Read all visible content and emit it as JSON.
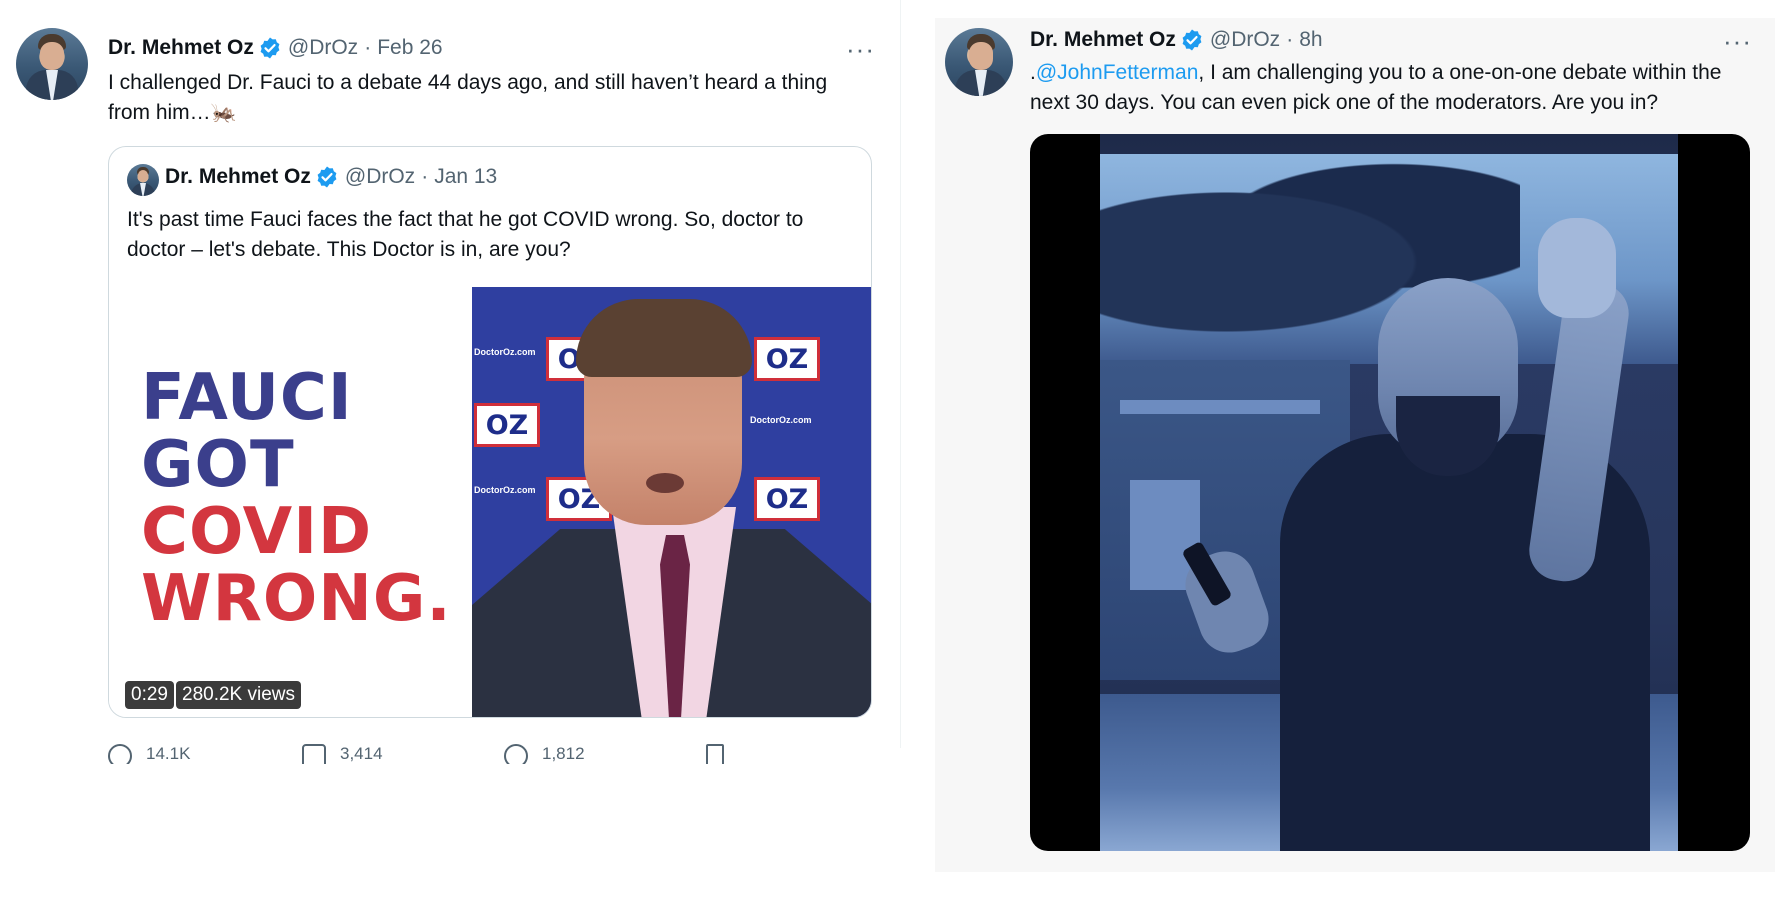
{
  "left_tweet": {
    "author_name": "Dr. Mehmet Oz",
    "handle": "@DrOz",
    "date": "Feb 26",
    "separator": "·",
    "more": "···",
    "text": "I challenged Dr. Fauci to a debate 44 days ago, and still haven’t heard a thing from him…🦗",
    "quoted": {
      "author_name": "Dr. Mehmet Oz",
      "handle": "@DrOz",
      "date": "Jan 13",
      "separator": "·",
      "text": "It's past time Fauci faces the fact that he got COVID wrong. So, doctor to doctor – let's debate. This Doctor is in, are you?",
      "media_lines": [
        {
          "text": "FAUCI",
          "color": "#3b3f8c"
        },
        {
          "text": "GOT",
          "color": "#3b3f8c"
        },
        {
          "text": "COVID",
          "color": "#d3363f"
        },
        {
          "text": "WRONG.",
          "color": "#d3363f"
        }
      ],
      "backdrop_logo": "OZ",
      "backdrop_url": "DoctorOz.com",
      "duration": "0:29",
      "views": "280.2K views"
    },
    "actions": {
      "reply": "14.1K",
      "retweet": "3,414",
      "like": "1,812"
    }
  },
  "right_tweet": {
    "author_name": "Dr. Mehmet Oz",
    "handle": "@DrOz",
    "separator": "·",
    "time": "8h",
    "more": "···",
    "text_prefix": ".",
    "mention": "@JohnFetterman",
    "text_rest": ", I am challenging you to a one-on-one debate within the next 30 days. You can even pick one of the moderators. Are you in?"
  },
  "colors": {
    "verified": "#1d9bf0",
    "link": "#1d9bf0",
    "muted": "#536471"
  }
}
